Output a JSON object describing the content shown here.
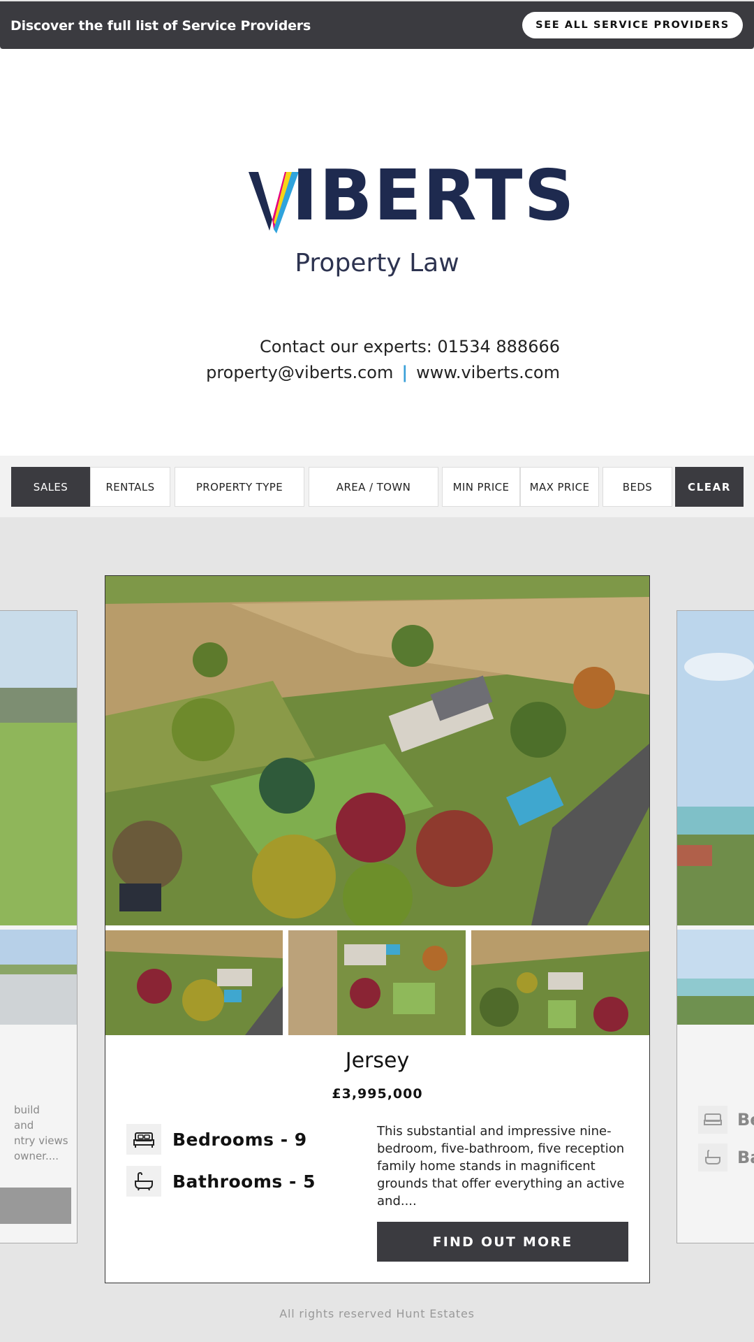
{
  "banner": {
    "text": "Discover the full list of Service Providers",
    "button_label": "SEE ALL SERVICE PROVIDERS"
  },
  "advert": {
    "logo_text": "VIBERTS",
    "logo_subtitle": "Property Law",
    "contact_line": "Contact our experts: 01534 888666",
    "email": "property@viberts.com",
    "separator": "|",
    "website": "www.viberts.com"
  },
  "filters": {
    "sales": "SALES",
    "rentals": "RENTALS",
    "property_type": "PROPERTY TYPE",
    "area_town": "AREA / TOWN",
    "min_price": "MIN PRICE",
    "max_price": "MAX PRICE",
    "beds": "BEDS",
    "clear": "CLEAR"
  },
  "listing": {
    "town": "Jersey",
    "price": "£3,995,000",
    "bedrooms": "Bedrooms - 9",
    "bathrooms": "Bathrooms - 5",
    "description": "This substantial and impressive nine-bedroom, five-bathroom, five reception family home stands in magnificent grounds that offer everything an active and....",
    "button_label": "FIND OUT MORE"
  },
  "left_card": {
    "text_lines": [
      "build",
      "and",
      "ntry views",
      " owner...."
    ]
  },
  "right_card": {
    "feat1": "Be",
    "feat2": "Ba"
  },
  "footer": {
    "text": "All rights reserved Hunt Estates"
  },
  "colors": {
    "dark": "#3b3b40",
    "logo_navy": "#1e2a4f",
    "separator_blue": "#3aa0d8"
  }
}
